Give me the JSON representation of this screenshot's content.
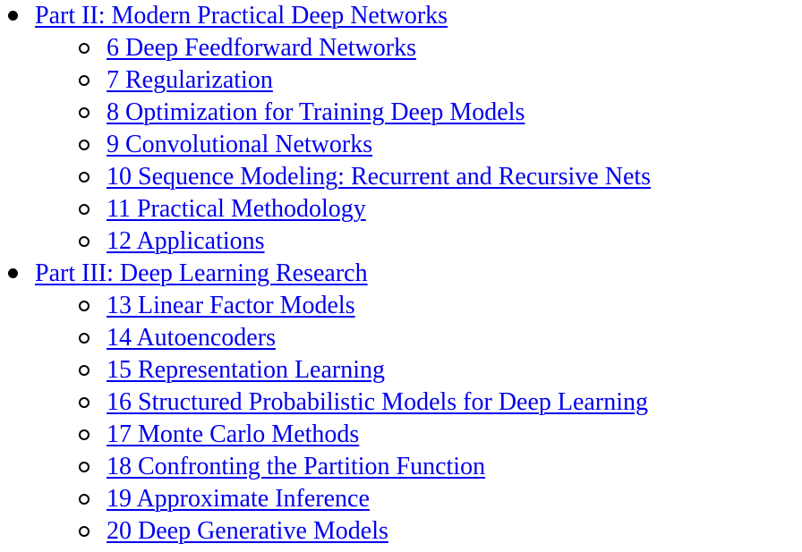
{
  "colors": {
    "link": "#0000ee",
    "text": "#000000",
    "background": "#ffffff"
  },
  "bullets": {
    "part": "disc-bullet",
    "chapter": "circle-bullet"
  },
  "parts": [
    {
      "label": "Part II: Modern Practical Deep Networks",
      "chapters": [
        "6 Deep Feedforward Networks",
        "7 Regularization",
        "8 Optimization for Training Deep Models",
        "9 Convolutional Networks",
        "10 Sequence Modeling: Recurrent and Recursive Nets",
        "11 Practical Methodology",
        "12 Applications"
      ]
    },
    {
      "label": "Part III: Deep Learning Research",
      "chapters": [
        "13 Linear Factor Models",
        "14 Autoencoders",
        "15 Representation Learning",
        "16 Structured Probabilistic Models for Deep Learning",
        "17 Monte Carlo Methods",
        "18 Confronting the Partition Function",
        "19 Approximate Inference",
        "20 Deep Generative Models"
      ]
    }
  ]
}
